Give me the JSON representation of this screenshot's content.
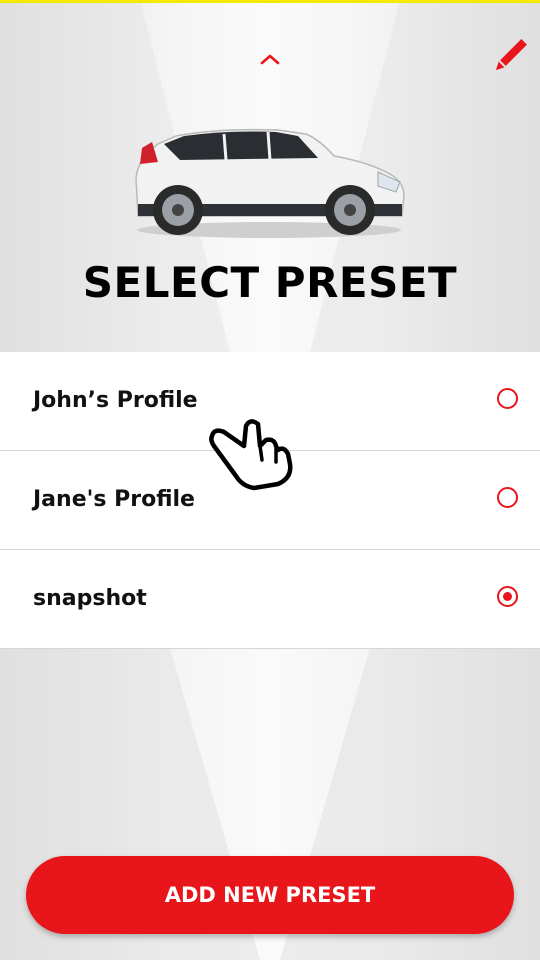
{
  "header": {
    "collapse_icon": "chevron-up-icon",
    "edit_icon": "pencil-icon",
    "title": "SELECT PRESET"
  },
  "presets": [
    {
      "label": "John’s Profile",
      "selected": false
    },
    {
      "label": "Jane's Profile",
      "selected": false
    },
    {
      "label": "snapshot",
      "selected": true
    }
  ],
  "overlay": {
    "icon": "pointing-hand-icon"
  },
  "footer": {
    "add_label": "ADD NEW PRESET"
  },
  "colors": {
    "accent": "#e8161b",
    "top_bar": "#f6e800",
    "row_bg": "#ffffff",
    "text": "#111111"
  }
}
